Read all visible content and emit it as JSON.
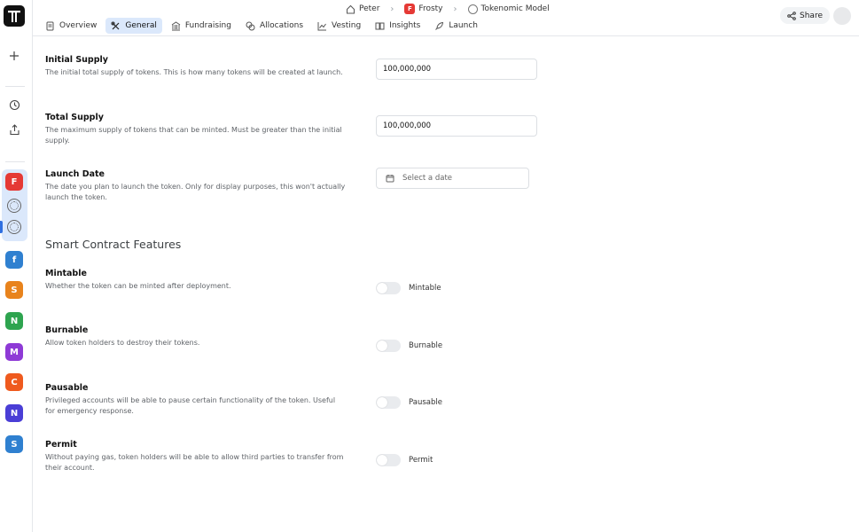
{
  "breadcrumb": {
    "user": "Peter",
    "project": "Frosty",
    "project_badge": "F",
    "model": "Tokenomic Model"
  },
  "tabs": [
    {
      "label": "Overview",
      "icon": "document-icon"
    },
    {
      "label": "General",
      "icon": "tools-icon",
      "active": true
    },
    {
      "label": "Fundraising",
      "icon": "bank-icon"
    },
    {
      "label": "Allocations",
      "icon": "coins-icon"
    },
    {
      "label": "Vesting",
      "icon": "chart-icon"
    },
    {
      "label": "Insights",
      "icon": "book-icon"
    },
    {
      "label": "Launch",
      "icon": "rocket-icon"
    }
  ],
  "share_label": "Share",
  "sidebar_projects": [
    {
      "letter": "F",
      "color": "#e53935"
    },
    {
      "letter": "f",
      "color": "#2f80d0"
    },
    {
      "letter": "S",
      "color": "#e8831c"
    },
    {
      "letter": "N",
      "color": "#2ea44f"
    },
    {
      "letter": "M",
      "color": "#8e3ad6"
    },
    {
      "letter": "C",
      "color": "#ef5a1e"
    },
    {
      "letter": "N",
      "color": "#4a3ed6"
    },
    {
      "letter": "S",
      "color": "#2f80d0"
    }
  ],
  "fields": {
    "initial_supply": {
      "label": "Initial Supply",
      "desc": "The initial total supply of tokens. This is how many tokens will be created at launch.",
      "value": "100,000,000"
    },
    "total_supply": {
      "label": "Total Supply",
      "desc": "The maximum supply of tokens that can be minted. Must be greater than the initial supply.",
      "value": "100,000,000"
    },
    "launch_date": {
      "label": "Launch Date",
      "desc": "The date you plan to launch the token. Only for display purposes, this won't actually launch the token.",
      "placeholder": "Select a date"
    }
  },
  "section_title": "Smart Contract Features",
  "features": {
    "mintable": {
      "label": "Mintable",
      "desc": "Whether the token can be minted after deployment.",
      "toggle_label": "Mintable",
      "enabled": false
    },
    "burnable": {
      "label": "Burnable",
      "desc": "Allow token holders to destroy their tokens.",
      "toggle_label": "Burnable",
      "enabled": false
    },
    "pausable": {
      "label": "Pausable",
      "desc": "Privileged accounts will be able to pause certain functionality of the token. Useful for emergency response.",
      "toggle_label": "Pausable",
      "enabled": false
    },
    "permit": {
      "label": "Permit",
      "desc": "Without paying gas, token holders will be able to allow third parties to transfer from their account.",
      "toggle_label": "Permit",
      "enabled": false
    }
  }
}
